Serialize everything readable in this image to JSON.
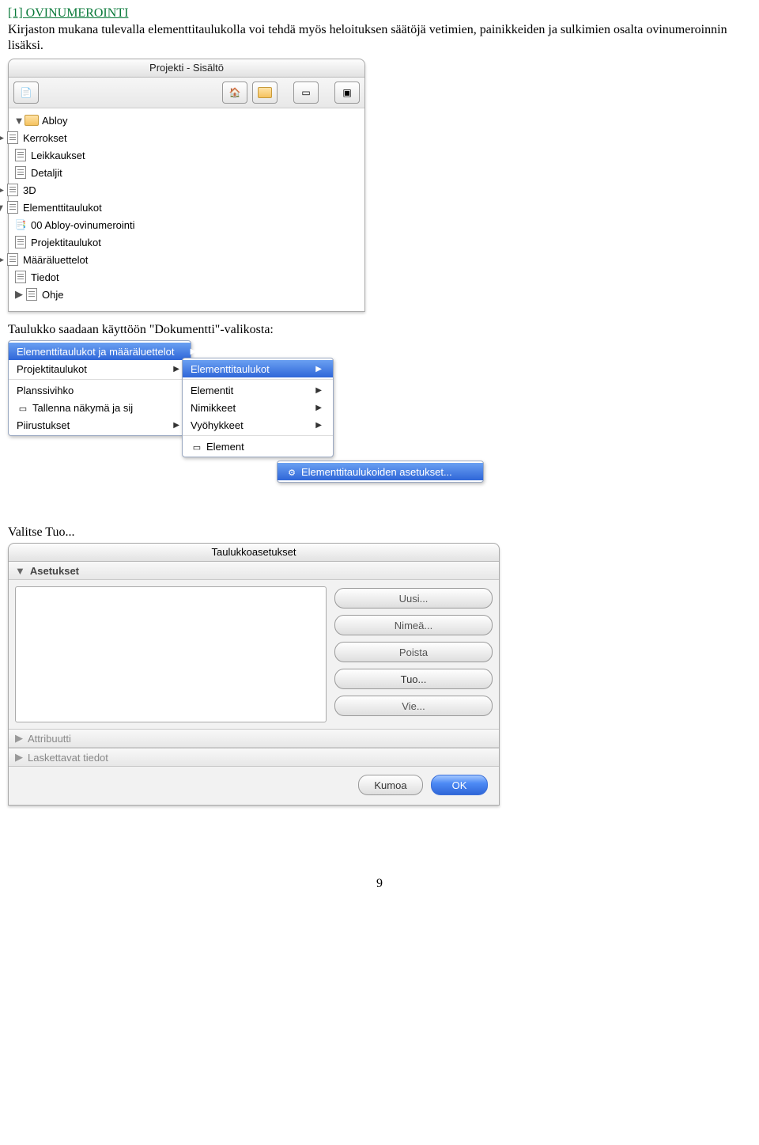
{
  "heading": "[1] OVINUMEROINTI",
  "intro": "Kirjaston mukana tulevalla elementtitaulukolla voi tehdä myös heloituksen säätöjä vetimien, painikkeiden ja sulkimien osalta ovinumeroinnin lisäksi.",
  "panel1": {
    "title": "Projekti - Sisältö",
    "root": "Abloy",
    "items": {
      "kerrokset": "Kerrokset",
      "leikkaukset": "Leikkaukset",
      "detaljit": "Detaljit",
      "three_d": "3D",
      "elementtitaulukot": "Elementtitaulukot",
      "abloy_ovinumerointi": "00 Abloy-ovinumerointi",
      "projektitaulukot": "Projektitaulukot",
      "maaraluettelot": "Määräluettelot",
      "tiedot": "Tiedot",
      "ohje": "Ohje"
    }
  },
  "caption1": "Taulukko saadaan käyttöön \"Dokumentti\"-valikosta:",
  "menu": {
    "m1": {
      "a": "Elementtitaulukot ja määräluettelot",
      "b": "Projektitaulukot",
      "c": "Planssivihko",
      "d": "Tallenna näkymä ja sij",
      "e": "Piirustukset"
    },
    "m2": {
      "a": "Elementtitaulukot",
      "b": "Elementit",
      "c": "Nimikkeet",
      "d": "Vyöhykkeet",
      "e": "Element"
    },
    "m3": {
      "a": "Elementtitaulukoiden asetukset..."
    }
  },
  "caption2": "Valitse Tuo...",
  "panel3": {
    "title": "Taulukkoasetukset",
    "sections": {
      "asetukset": "Asetukset",
      "attribuutti": "Attribuutti",
      "laskettavat": "Laskettavat tiedot"
    },
    "buttons": {
      "uusi": "Uusi...",
      "nimea": "Nimeä...",
      "poista": "Poista",
      "tuo": "Tuo...",
      "vie": "Vie...",
      "kumoa": "Kumoa",
      "ok": "OK"
    }
  },
  "page_number": "9"
}
